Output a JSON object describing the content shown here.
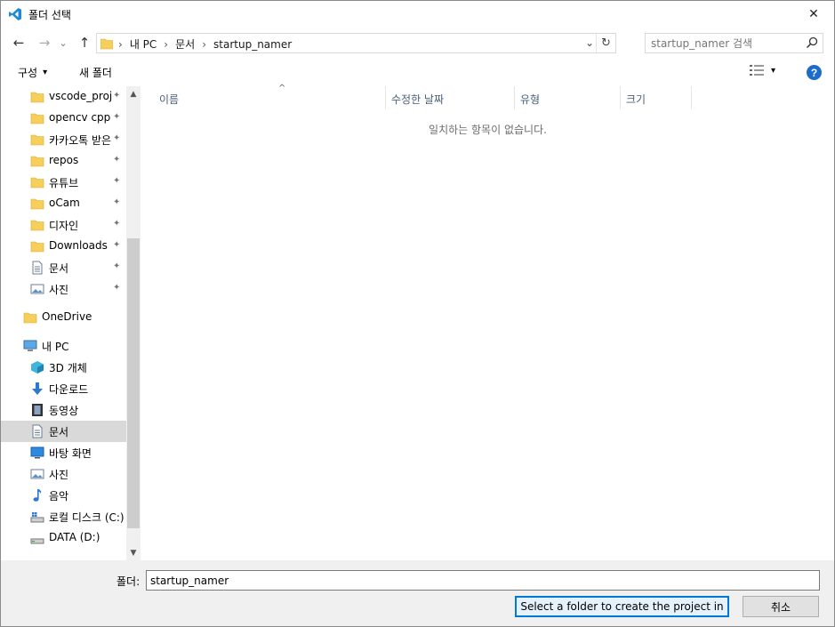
{
  "window": {
    "title": "폴더 선택",
    "close_glyph": "✕"
  },
  "nav": {
    "back_glyph": "←",
    "forward_glyph": "→",
    "history_glyph": "⌄",
    "up_glyph": "↑",
    "breadcrumb": [
      "내 PC",
      "문서",
      "startup_namer"
    ],
    "sep_glyph": "›",
    "dropdown_glyph": "⌄",
    "refresh_glyph": "↻",
    "search_placeholder": "startup_namer 검색"
  },
  "toolbar": {
    "organize_label": "구성",
    "organize_arrow": "▾",
    "new_folder_label": "새 폴더",
    "view_arrow": "▾",
    "help_label": "?"
  },
  "sidebar": {
    "pin_glyph": "📌",
    "items": [
      {
        "label": "vscode_proje",
        "icon": "folder-icon",
        "pinned": true
      },
      {
        "label": "opencv cpp c",
        "icon": "folder-icon",
        "pinned": true
      },
      {
        "label": "카카오톡 받은",
        "icon": "folder-icon",
        "pinned": true
      },
      {
        "label": "repos",
        "icon": "folder-icon",
        "pinned": true
      },
      {
        "label": "유튜브",
        "icon": "folder-icon",
        "pinned": true
      },
      {
        "label": "oCam",
        "icon": "folder-icon",
        "pinned": true
      },
      {
        "label": "디자인",
        "icon": "folder-icon",
        "pinned": true
      },
      {
        "label": "Downloads",
        "icon": "folder-icon",
        "pinned": true
      },
      {
        "label": "문서",
        "icon": "document-icon",
        "pinned": true
      },
      {
        "label": "사진",
        "icon": "picture-icon",
        "pinned": true
      },
      {
        "label": "OneDrive",
        "icon": "folder-icon",
        "pinned": false
      },
      {
        "label": "내 PC",
        "icon": "pc-icon",
        "pinned": false
      },
      {
        "label": "3D 개체",
        "icon": "cube-icon",
        "pinned": false
      },
      {
        "label": "다운로드",
        "icon": "download-icon",
        "pinned": false
      },
      {
        "label": "동영상",
        "icon": "video-icon",
        "pinned": false
      },
      {
        "label": "문서",
        "icon": "document-icon",
        "pinned": false,
        "selected": true
      },
      {
        "label": "바탕 화면",
        "icon": "desktop-icon",
        "pinned": false
      },
      {
        "label": "사진",
        "icon": "picture-icon",
        "pinned": false
      },
      {
        "label": "음악",
        "icon": "music-icon",
        "pinned": false
      },
      {
        "label": "로컬 디스크 (C:)",
        "icon": "drive-c-icon",
        "pinned": false
      },
      {
        "label": "DATA (D:)",
        "icon": "drive-d-icon",
        "pinned": false
      }
    ],
    "scroll_up_glyph": "▲",
    "scroll_down_glyph": "▼"
  },
  "filelist": {
    "columns": [
      "이름",
      "수정한 날짜",
      "유형",
      "크기"
    ],
    "sort_glyph": "^",
    "empty_message": "일치하는 항목이 없습니다."
  },
  "footer": {
    "folder_label": "폴더:",
    "folder_value": "startup_namer",
    "select_button": "Select a folder to create the project in",
    "cancel_button": "취소"
  },
  "colors": {
    "accent": "#0078d7",
    "vscode_blue": "#1f8ad2",
    "folder_yellow": "#f6cf5b",
    "help_blue": "#1d6cc7",
    "selection": "#d9d9d9"
  }
}
